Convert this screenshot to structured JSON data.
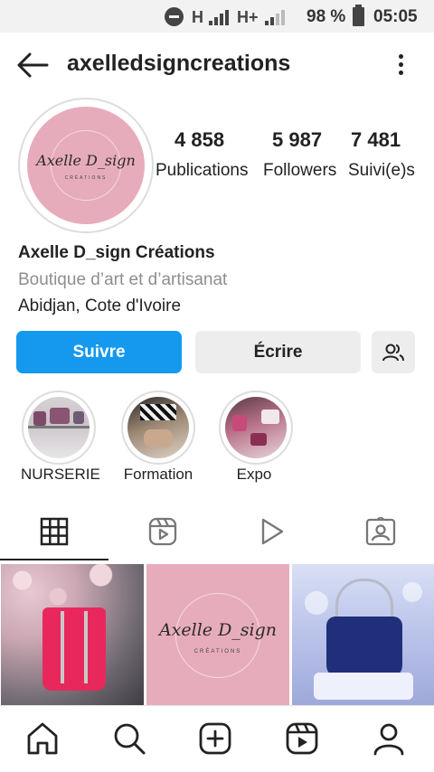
{
  "status_bar": {
    "network_1": "H",
    "network_2": "H+",
    "battery_percent": "98 %",
    "time": "05:05",
    "icons": [
      "do-not-disturb-icon",
      "signal-icon",
      "signal-icon",
      "battery-icon"
    ]
  },
  "header": {
    "username": "axelledsigncreations",
    "icons": [
      "back-arrow-icon",
      "more-options-icon"
    ]
  },
  "profile": {
    "avatar_logo_text": "Axelle D_sign",
    "avatar_logo_subtext": "CRÉATIONS",
    "stats": [
      {
        "value": "4 858",
        "label": "Publications"
      },
      {
        "value": "5 987",
        "label": "Followers"
      },
      {
        "value": "7 481",
        "label": "Suivi(e)s"
      }
    ],
    "name": "Axelle D_sign Créations",
    "category": "Boutique d’art et d’artisanat",
    "location": "Abidjan, Cote d'Ivoire"
  },
  "actions": {
    "follow_label": "Suivre",
    "message_label": "Écrire",
    "suggest_icon": "add-person-icon"
  },
  "highlights": [
    {
      "label": "NURSERIE"
    },
    {
      "label": "Formation"
    },
    {
      "label": "Expo"
    }
  ],
  "tabs": [
    "grid-icon",
    "reels-icon",
    "play-icon",
    "tagged-icon"
  ],
  "posts": [
    {
      "logo_text": ""
    },
    {
      "logo_text": "Axelle D_sign",
      "logo_subtext": "CRÉATIONS"
    },
    {
      "logo_text": ""
    }
  ],
  "bottom_nav": [
    "home-icon",
    "search-icon",
    "create-icon",
    "reels-icon",
    "profile-icon"
  ],
  "colors": {
    "follow_button": "#1499ee",
    "brand_pink": "#e7acbb"
  }
}
